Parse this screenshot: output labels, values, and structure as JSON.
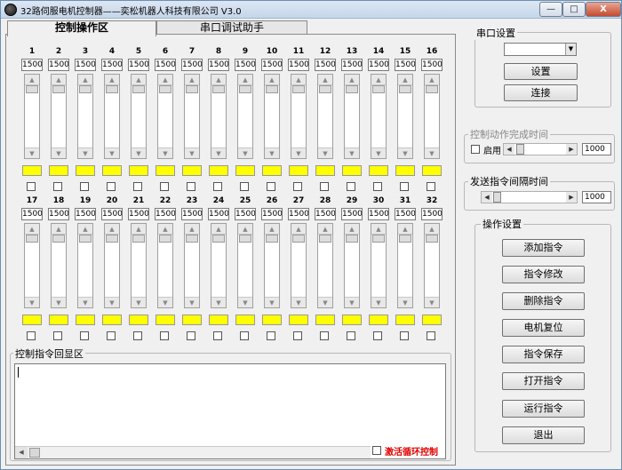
{
  "window": {
    "title": "32路伺服电机控制器——奕松机器人科技有限公司 V3.0"
  },
  "titlebar_buttons": {
    "minimize": "—",
    "maximize": "□",
    "close": "X"
  },
  "tabs": [
    {
      "label": "控制操作区",
      "selected": true
    },
    {
      "label": "串口调试助手",
      "selected": false
    }
  ],
  "channels_row1": [
    {
      "num": "1",
      "value": "1500"
    },
    {
      "num": "2",
      "value": "1500"
    },
    {
      "num": "3",
      "value": "1500"
    },
    {
      "num": "4",
      "value": "1500"
    },
    {
      "num": "5",
      "value": "1500"
    },
    {
      "num": "6",
      "value": "1500"
    },
    {
      "num": "7",
      "value": "1500"
    },
    {
      "num": "8",
      "value": "1500"
    },
    {
      "num": "9",
      "value": "1500"
    },
    {
      "num": "10",
      "value": "1500"
    },
    {
      "num": "11",
      "value": "1500"
    },
    {
      "num": "12",
      "value": "1500"
    },
    {
      "num": "13",
      "value": "1500"
    },
    {
      "num": "14",
      "value": "1500"
    },
    {
      "num": "15",
      "value": "1500"
    },
    {
      "num": "16",
      "value": "1500"
    }
  ],
  "channels_row2": [
    {
      "num": "17",
      "value": "1500"
    },
    {
      "num": "18",
      "value": "1500"
    },
    {
      "num": "19",
      "value": "1500"
    },
    {
      "num": "20",
      "value": "1500"
    },
    {
      "num": "21",
      "value": "1500"
    },
    {
      "num": "22",
      "value": "1500"
    },
    {
      "num": "23",
      "value": "1500"
    },
    {
      "num": "24",
      "value": "1500"
    },
    {
      "num": "25",
      "value": "1500"
    },
    {
      "num": "26",
      "value": "1500"
    },
    {
      "num": "27",
      "value": "1500"
    },
    {
      "num": "28",
      "value": "1500"
    },
    {
      "num": "29",
      "value": "1500"
    },
    {
      "num": "30",
      "value": "1500"
    },
    {
      "num": "31",
      "value": "1500"
    },
    {
      "num": "32",
      "value": "1500"
    }
  ],
  "indicator_color": "#ffff00",
  "echo": {
    "label": "控制指令回显区",
    "text": "",
    "loop_label": "激活循环控制",
    "loop_checked": false,
    "loop_color": "#e00000"
  },
  "serial": {
    "group_label": "串口设置",
    "port_value": "",
    "setup_button": "设置",
    "connect_button": "连接"
  },
  "action_time": {
    "group_label": "控制动作完成时间",
    "enable_label": "启用",
    "enabled": false,
    "value": "1000"
  },
  "send_interval": {
    "group_label": "发送指令间隔时间",
    "value": "1000"
  },
  "operations": {
    "group_label": "操作设置",
    "buttons": [
      "添加指令",
      "指令修改",
      "删除指令",
      "电机复位",
      "指令保存",
      "打开指令",
      "运行指令",
      "退出"
    ]
  }
}
